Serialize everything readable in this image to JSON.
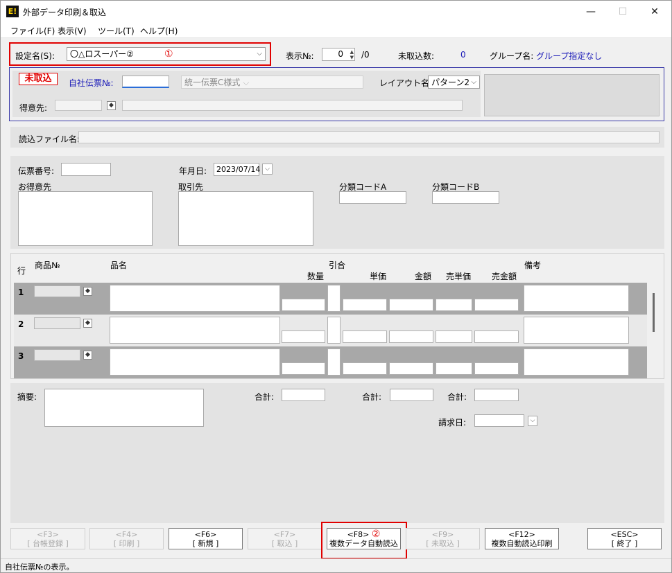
{
  "window": {
    "title": "外部データ印刷＆取込",
    "icon_text": "E!",
    "minimize": "—",
    "maximize": "☐",
    "close": "✕"
  },
  "menu": [
    "ファイル(F)",
    "表示(V)",
    "ツール(T)",
    "ヘルプ(H)"
  ],
  "header": {
    "setting_label": "設定名(S):",
    "setting_value": "〇△ロスーパー②",
    "annot_1": "①",
    "display_no_label": "表示№:",
    "display_no_value": "0",
    "display_no_total": "/0",
    "unread_label": "未取込数:",
    "unread_value": "0",
    "group_label": "グループ名:",
    "group_value": "グループ指定なし"
  },
  "info_box": {
    "status_badge": "未取込",
    "voucher_no_label": "自社伝票№:",
    "form_select": "統一伝票C様式",
    "layout_label": "レイアウト名:",
    "layout_value": "パターン2",
    "customer_label": "得意先:"
  },
  "file": {
    "label": "読込ファイル名:"
  },
  "slip": {
    "slip_no_label": "伝票番号:",
    "date_label": "年月日:",
    "date_value": "2023/07/14",
    "customer_label": "お得意先",
    "partner_label": "取引先",
    "class_a_label": "分類コードA",
    "class_b_label": "分類コードB"
  },
  "grid": {
    "headers": {
      "row": "行",
      "product_no": "商品№",
      "item_name": "品名",
      "hikiai": "引合",
      "qty": "数量",
      "unit_price": "単価",
      "amount": "金額",
      "sale_price": "売単価",
      "sale_amount": "売金額",
      "remarks": "備考"
    },
    "rows": [
      "1",
      "2",
      "3"
    ]
  },
  "footer": {
    "summary_label": "摘要:",
    "total_label": "合計:",
    "billing_date_label": "請求日:"
  },
  "fkeys": [
    {
      "key": "<F3>",
      "label": "[ 台帳登録 ]"
    },
    {
      "key": "<F4>",
      "label": "[ 印刷 ]"
    },
    {
      "key": "<F6>",
      "label": "[ 新規 ]"
    },
    {
      "key": "<F7>",
      "label": "[ 取込 ]"
    },
    {
      "key": "<F8>",
      "label": "複数データ自動読込",
      "annot": "②"
    },
    {
      "key": "<F9>",
      "label": "[ 未取込 ]"
    },
    {
      "key": "<F12>",
      "label": "複数自動読込印刷"
    },
    {
      "key": "<ESC>",
      "label": "[ 終了 ]"
    }
  ],
  "status_bar": "自社伝票№の表示。",
  "colors": {
    "accent_blue": "#1a1ab8",
    "annotation_red": "#e00000",
    "grid_dark": "#a8a8a8"
  }
}
